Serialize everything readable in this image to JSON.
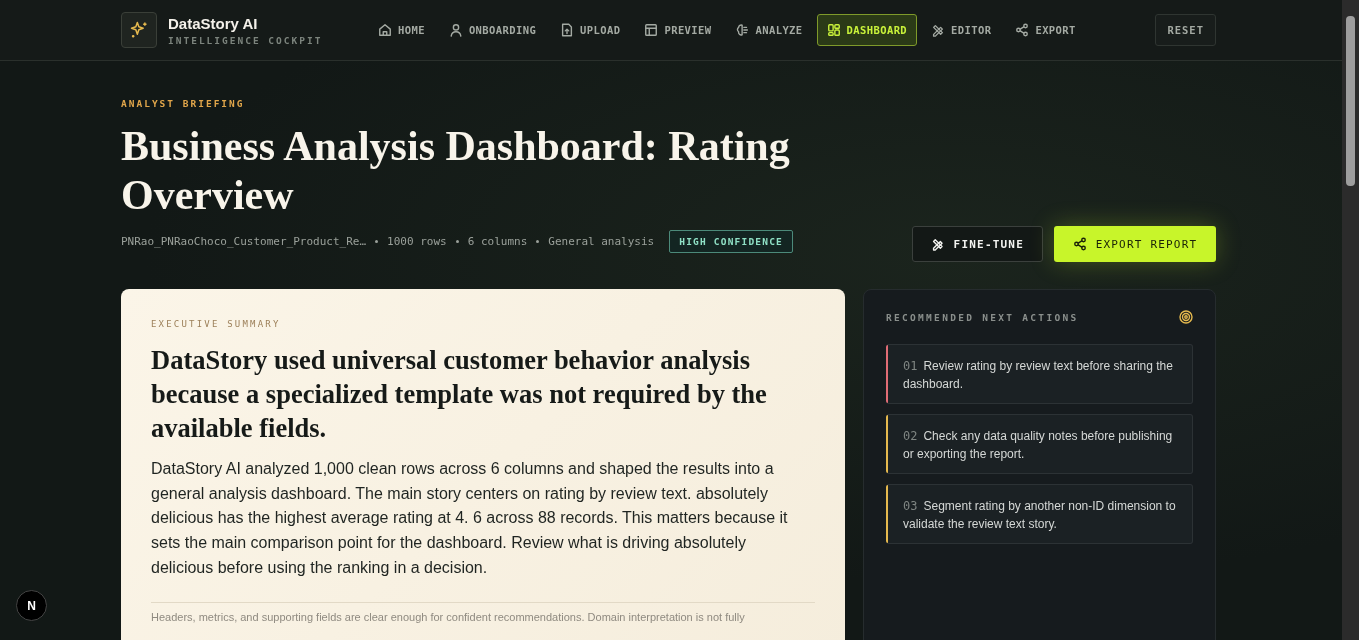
{
  "brand": {
    "name": "DataStory AI",
    "tagline": "INTELLIGENCE COCKPIT"
  },
  "nav": [
    {
      "label": "HOME",
      "selected": false
    },
    {
      "label": "ONBOARDING",
      "selected": false
    },
    {
      "label": "UPLOAD",
      "selected": false
    },
    {
      "label": "PREVIEW",
      "selected": false
    },
    {
      "label": "ANALYZE",
      "selected": false
    },
    {
      "label": "DASHBOARD",
      "selected": true
    },
    {
      "label": "EDITOR",
      "selected": false
    },
    {
      "label": "EXPORT",
      "selected": false
    }
  ],
  "reset_button": "RESET",
  "hero": {
    "eyebrow": "ANALYST BRIEFING",
    "title": "Business Analysis Dashboard: Rating Overview",
    "meta": [
      "PNRao_PNRaoChoco_Customer_Product_Re…",
      "1000 rows",
      "6 columns",
      "General analysis"
    ],
    "confidence_badge": "HIGH CONFIDENCE",
    "buttons": [
      {
        "label": "FINE-TUNE",
        "kind": "outline"
      },
      {
        "label": "EXPORT REPORT",
        "kind": "primary"
      }
    ]
  },
  "summary": {
    "eyebrow": "EXECUTIVE SUMMARY",
    "headline": "DataStory used universal customer behavior analysis because a specialized template was not required by the available fields.",
    "body": "DataStory AI analyzed 1,000 clean rows across 6 columns and shaped the results into a general analysis dashboard. The main story centers on rating by review text. absolutely delicious has the highest average rating at 4. 6 across 88 records. This matters because it sets the main comparison point for the dashboard. Review what is driving absolutely delicious before using the ranking in a decision.",
    "note": "Headers, metrics, and supporting fields are clear enough for confident recommendations. Domain interpretation is not fully"
  },
  "actions": {
    "title": "RECOMMENDED NEXT ACTIONS",
    "items": [
      {
        "number": "01",
        "text": "Review rating by review text before sharing the dashboard.",
        "color": "#e06c75"
      },
      {
        "number": "02",
        "text": "Check any data quality notes before publishing or exporting the report.",
        "color": "#e5b94e"
      },
      {
        "number": "03",
        "text": "Segment rating by another non-ID dimension to validate the review text story.",
        "color": "#e5b94e"
      }
    ]
  },
  "dev_badge": "N"
}
